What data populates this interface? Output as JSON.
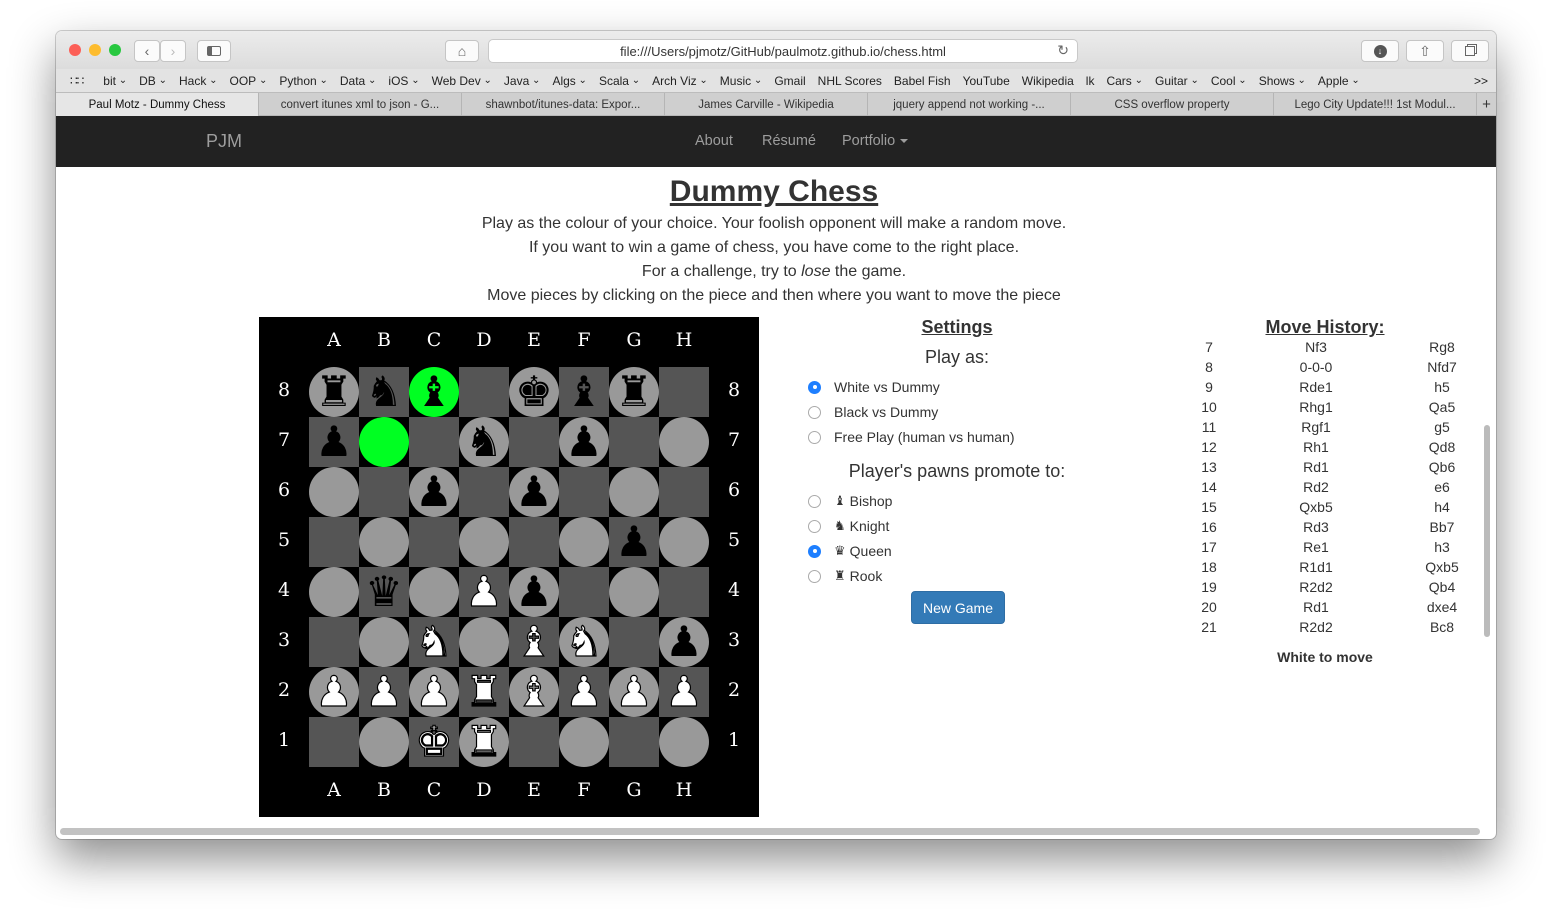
{
  "browser": {
    "url": "file:///Users/pjmotz/GitHub/paulmotz.github.io/chess.html",
    "bookmarks": [
      {
        "label": "bit",
        "dd": true
      },
      {
        "label": "DB",
        "dd": true
      },
      {
        "label": "Hack",
        "dd": true
      },
      {
        "label": "OOP",
        "dd": true
      },
      {
        "label": "Python",
        "dd": true
      },
      {
        "label": "Data",
        "dd": true
      },
      {
        "label": "iOS",
        "dd": true
      },
      {
        "label": "Web Dev",
        "dd": true
      },
      {
        "label": "Java",
        "dd": true
      },
      {
        "label": "Algs",
        "dd": true
      },
      {
        "label": "Scala",
        "dd": true
      },
      {
        "label": "Arch Viz",
        "dd": true
      },
      {
        "label": "Music",
        "dd": true
      },
      {
        "label": "Gmail",
        "dd": false
      },
      {
        "label": "NHL Scores",
        "dd": false
      },
      {
        "label": "Babel Fish",
        "dd": false
      },
      {
        "label": "YouTube",
        "dd": false
      },
      {
        "label": "Wikipedia",
        "dd": false
      },
      {
        "label": "lk",
        "dd": false
      },
      {
        "label": "Cars",
        "dd": true
      },
      {
        "label": "Guitar",
        "dd": true
      },
      {
        "label": "Cool",
        "dd": true
      },
      {
        "label": "Shows",
        "dd": true
      },
      {
        "label": "Apple",
        "dd": true
      }
    ],
    "bookmarks_more": ">>",
    "tabs": [
      "Paul Motz - Dummy Chess",
      "convert itunes xml to json - G...",
      "shawnbot/itunes-data: Expor...",
      "James Carville - Wikipedia",
      "jquery append not working -...",
      "CSS overflow property",
      "Lego City Update!!! 1st Modul..."
    ],
    "new_tab": "+"
  },
  "navbar": {
    "brand": "PJM",
    "links": [
      "About",
      "Résumé",
      "Portfolio"
    ]
  },
  "page": {
    "title": "Dummy Chess",
    "intro": [
      "Play as the colour of your choice. Your foolish opponent will make a random move.",
      "If you want to win a game of chess, you have come to the right place.",
      "For a challenge, try to lose the game.",
      "Move pieces by clicking on the piece and then where you want to move the piece"
    ],
    "intro_emphasis": "lose"
  },
  "board": {
    "files": [
      "A",
      "B",
      "C",
      "D",
      "E",
      "F",
      "G",
      "H"
    ],
    "ranks": [
      "8",
      "7",
      "6",
      "5",
      "4",
      "3",
      "2",
      "1"
    ],
    "highlight_color": "#00ff22",
    "highlighted": [
      "c8",
      "b7"
    ],
    "pieces": {
      "a8": "br",
      "b8": "bn",
      "c8": "bb",
      "e8": "bk",
      "f8": "bb",
      "g8": "br",
      "a7": "bp",
      "d7": "bn",
      "f7": "bp",
      "c6": "bp",
      "e6": "bp",
      "g5": "bp",
      "b4": "bq",
      "d4": "wp",
      "e4": "bp",
      "c3": "wn",
      "e3": "wb",
      "f3": "wn",
      "h3": "bp",
      "a2": "wp",
      "b2": "wp",
      "c2": "wp",
      "d2": "wr",
      "e2": "wb",
      "f2": "wp",
      "g2": "wp",
      "h2": "wp",
      "c1": "wk",
      "d1": "wr"
    }
  },
  "settings": {
    "heading": "Settings",
    "play_as_label": "Play as:",
    "play_as": [
      {
        "label": "White vs Dummy",
        "checked": true
      },
      {
        "label": "Black vs Dummy",
        "checked": false
      },
      {
        "label": "Free Play (human vs human)",
        "checked": false
      }
    ],
    "promote_label": "Player's pawns promote to:",
    "promote": [
      {
        "label": "Bishop",
        "icon": "bishop-icon",
        "checked": false
      },
      {
        "label": "Knight",
        "icon": "knight-icon",
        "checked": false
      },
      {
        "label": "Queen",
        "icon": "queen-icon",
        "checked": true
      },
      {
        "label": "Rook",
        "icon": "rook-icon",
        "checked": false
      }
    ],
    "new_game_label": "New Game"
  },
  "history": {
    "heading": "Move History:",
    "moves": [
      [
        "7",
        "Nf3",
        "Rg8"
      ],
      [
        "8",
        "0-0-0",
        "Nfd7"
      ],
      [
        "9",
        "Rde1",
        "h5"
      ],
      [
        "10",
        "Rhg1",
        "Qa5"
      ],
      [
        "11",
        "Rgf1",
        "g5"
      ],
      [
        "12",
        "Rh1",
        "Qd8"
      ],
      [
        "13",
        "Rd1",
        "Qb6"
      ],
      [
        "14",
        "Rd2",
        "e6"
      ],
      [
        "15",
        "Qxb5",
        "h4"
      ],
      [
        "16",
        "Rd3",
        "Bb7"
      ],
      [
        "17",
        "Re1",
        "h3"
      ],
      [
        "18",
        "R1d1",
        "Qxb5"
      ],
      [
        "19",
        "R2d2",
        "Qb4"
      ],
      [
        "20",
        "Rd1",
        "dxe4"
      ],
      [
        "21",
        "R2d2",
        "Bc8"
      ]
    ],
    "status": "White to move"
  }
}
